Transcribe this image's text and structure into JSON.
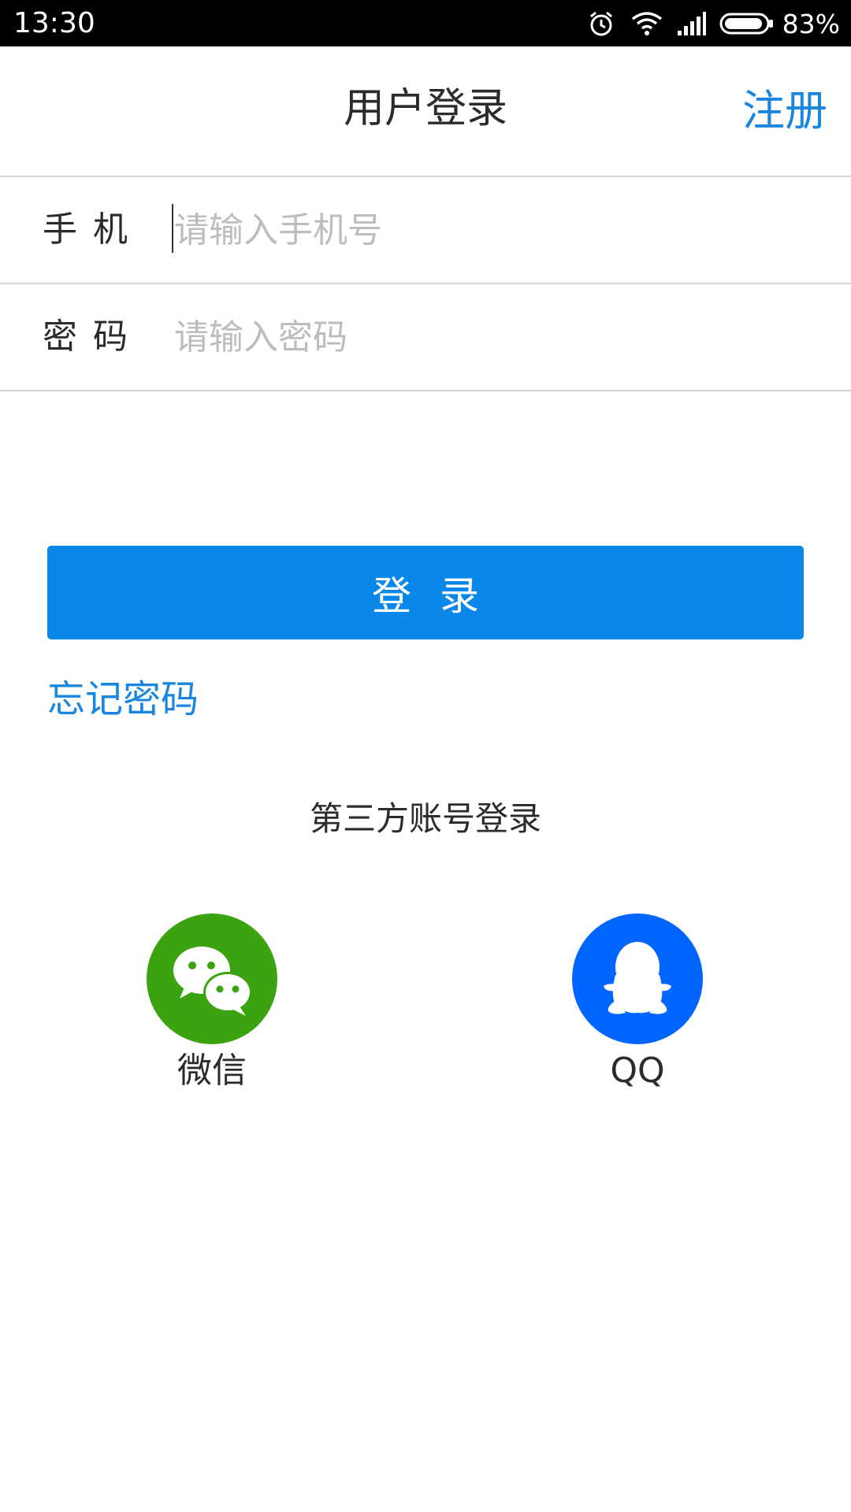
{
  "status_bar": {
    "time": "13:30",
    "battery_percent": "83%",
    "icons": [
      "alarm-icon",
      "wifi-icon",
      "signal-icon",
      "battery-icon"
    ]
  },
  "header": {
    "title": "用户登录",
    "register_label": "注册"
  },
  "form": {
    "phone": {
      "label": "手机",
      "placeholder": "请输入手机号",
      "value": ""
    },
    "password": {
      "label": "密码",
      "placeholder": "请输入密码",
      "value": ""
    }
  },
  "login_button_label": "登录",
  "forgot_password_label": "忘记密码",
  "third_party": {
    "title": "第三方账号登录",
    "providers": [
      {
        "label": "微信",
        "icon": "wechat-icon",
        "color": "#3aa30f"
      },
      {
        "label": "QQ",
        "icon": "qq-icon",
        "color": "#0066ff"
      }
    ]
  },
  "colors": {
    "accent": "#1a86e0",
    "button": "#0a88ea"
  }
}
